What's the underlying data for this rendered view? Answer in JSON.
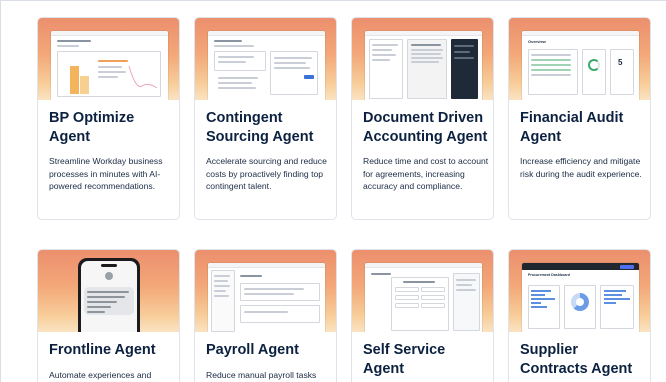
{
  "cards": [
    {
      "title_line1": "BP Optimize",
      "title_line2": "Agent",
      "description": "Streamline Workday business processes in minutes with AI-powered recommendations."
    },
    {
      "title_line1": "Contingent",
      "title_line2": "Sourcing Agent",
      "description": "Accelerate sourcing and reduce costs by proactively finding top contingent talent."
    },
    {
      "title_line1": "Document Driven",
      "title_line2": "Accounting Agent",
      "description": "Reduce time and cost to account for agreements, increasing accuracy and compliance."
    },
    {
      "title_line1": "Financial Audit",
      "title_line2": "Agent",
      "description": "Increase efficiency and mitigate risk during the audit experience."
    },
    {
      "title_line1": "Frontline Agent",
      "title_line2": "",
      "description": "Automate experiences and"
    },
    {
      "title_line1": "Payroll Agent",
      "title_line2": "",
      "description": "Reduce manual payroll tasks"
    },
    {
      "title_line1": "Self Service",
      "title_line2": "Agent",
      "description": ""
    },
    {
      "title_line1": "Supplier",
      "title_line2": "Contracts Agent",
      "description": ""
    }
  ],
  "thumbnails": {
    "financial_audit_heading": "Overview",
    "financial_audit_value": "5",
    "supplier_contracts_heading": "Procurement Dashboard"
  },
  "colors": {
    "title": "#0c2140",
    "text": "#1a2b45",
    "gradient_top": "#ec8f6e",
    "gradient_bottom": "#fae3c2",
    "card_border": "#dfe3ea"
  }
}
